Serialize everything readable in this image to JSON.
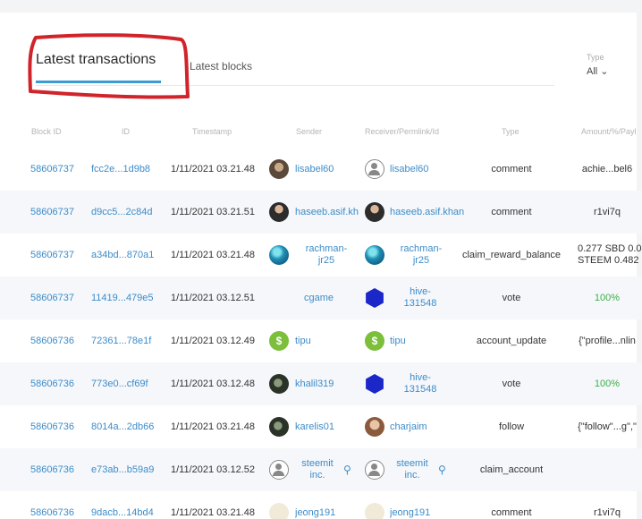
{
  "tabs": {
    "latest_transactions": "Latest transactions",
    "latest_blocks": "Latest blocks"
  },
  "filter": {
    "label": "Type",
    "value": "All"
  },
  "columns": [
    "Block ID",
    "ID",
    "Timestamp",
    "Sender",
    "Receiver/Permlink/Id",
    "Type",
    "Amount/%/Payl"
  ],
  "rows": [
    {
      "block": "58606737",
      "id": "fcc2e...1d9b8",
      "ts": "1/11/2021 03.21.48",
      "sender": "lisabel60",
      "receiver": "lisabel60",
      "type": "comment",
      "amount": "achie...bel6"
    },
    {
      "block": "58606737",
      "id": "d9cc5...2c84d",
      "ts": "1/11/2021 03.21.51",
      "sender": "haseeb.asif.kh",
      "receiver": "haseeb.asif.khan",
      "type": "comment",
      "amount": "r1vi7q"
    },
    {
      "block": "58606737",
      "id": "a34bd...870a1",
      "ts": "1/11/2021 03.21.48",
      "sender": "rachman-jr25",
      "receiver": "rachman-jr25",
      "type": "claim_reward_balance",
      "amount": "0.277 SBD 0.0 STEEM 0.482"
    },
    {
      "block": "58606737",
      "id": "11419...479e5",
      "ts": "1/11/2021 03.12.51",
      "sender": "cgame",
      "receiver": "hive-131548",
      "type": "vote",
      "amount": "100%"
    },
    {
      "block": "58606736",
      "id": "72361...78e1f",
      "ts": "1/11/2021 03.12.49",
      "sender": "tipu",
      "receiver": "tipu",
      "type": "account_update",
      "amount": "{\"profile...nlin"
    },
    {
      "block": "58606736",
      "id": "773e0...cf69f",
      "ts": "1/11/2021 03.12.48",
      "sender": "khalil319",
      "receiver": "hive-131548",
      "type": "vote",
      "amount": "100%"
    },
    {
      "block": "58606736",
      "id": "8014a...2db66",
      "ts": "1/11/2021 03.21.48",
      "sender": "karelis01",
      "receiver": "charjaim",
      "type": "follow",
      "amount": "{\"follow\"...g\",\""
    },
    {
      "block": "58606736",
      "id": "e73ab...b59a9",
      "ts": "1/11/2021 03.12.52",
      "sender": "steemit inc.",
      "receiver": "steemit inc.",
      "type": "claim_account",
      "amount": ""
    },
    {
      "block": "58606736",
      "id": "9dacb...14bd4",
      "ts": "1/11/2021 03.21.48",
      "sender": "jeong191",
      "receiver": "jeong191",
      "type": "comment",
      "amount": "r1vi7q"
    }
  ],
  "colors": {
    "link": "#3d8cc9",
    "accent": "#3d9bd4",
    "green": "#3fae48",
    "annotation": "#d1232a"
  }
}
